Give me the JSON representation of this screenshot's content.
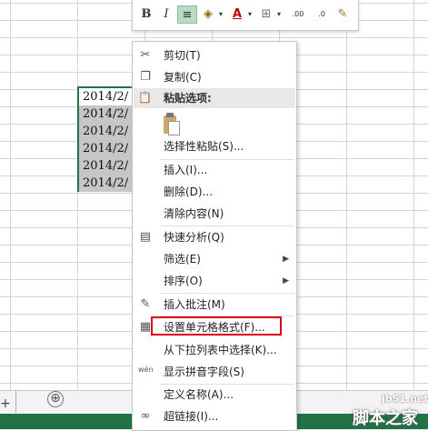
{
  "cells": [
    "2014/2/",
    "2014/2/",
    "2014/2/",
    "2014/2/",
    "2014/2/",
    "2014/2/"
  ],
  "sheet": {
    "tab_fragment": "+",
    "add_sheet": "⊕"
  },
  "mini_toolbar": {
    "bold": "B",
    "italic": "I",
    "align_center": "≡",
    "fill_color": "◈",
    "font_color": "A",
    "borders": "⊞",
    "increase_decimal": ".00",
    "decrease_decimal": ".0",
    "format_painter": "✎",
    "accent": "#b7dbc3"
  },
  "menu": {
    "cut": "剪切(T)",
    "copy": "复制(C)",
    "paste_options": "粘贴选项:",
    "paste_special": "选择性粘贴(S)...",
    "insert": "插入(I)...",
    "delete": "删除(D)...",
    "clear_contents": "清除内容(N)",
    "quick_analysis": "快速分析(Q)",
    "filter": "筛选(E)",
    "sort": "排序(O)",
    "insert_comment": "插入批注(M)",
    "format_cells": "设置单元格格式(F)...",
    "pick_from_list": "从下拉列表中选择(K)...",
    "phonetic": "显示拼音字段(S)",
    "define_name": "定义名称(A)...",
    "hyperlink": "超链接(I)..."
  },
  "icons": {
    "cut": "✂",
    "copy": "❐",
    "paste": "📋",
    "quick_analysis": "▤",
    "comment": "✎",
    "format_cells": "▦",
    "phonetic": "wén",
    "hyperlink": "∞"
  },
  "colors": {
    "selection_border": "#217346",
    "status_bar": "#217346",
    "highlight": "#d9001b"
  },
  "watermark": {
    "site": "jb51.net",
    "name": "脚本之家"
  }
}
